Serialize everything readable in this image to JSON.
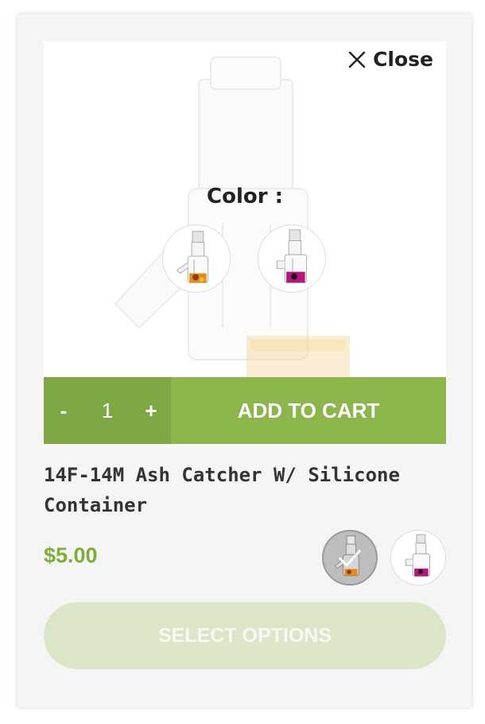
{
  "popup": {
    "close_label": "Close",
    "color_label": "Color :",
    "color_options": [
      {
        "name": "amber-yellow",
        "color": "#e68a1e"
      },
      {
        "name": "purple",
        "color": "#b0197a"
      }
    ]
  },
  "cart": {
    "minus": "-",
    "quantity": "1",
    "plus": "+",
    "add_to_cart": "ADD TO CART"
  },
  "product": {
    "title": "14F-14M Ash Catcher W/ Silicone Container",
    "price": "$5.00",
    "selected_variant": 0,
    "select_options": "SELECT OPTIONS"
  },
  "colors": {
    "accent": "#8cb64b",
    "accent_dark": "#7ea844",
    "price": "#7fac3b",
    "select_bg": "#dbe6c8"
  }
}
